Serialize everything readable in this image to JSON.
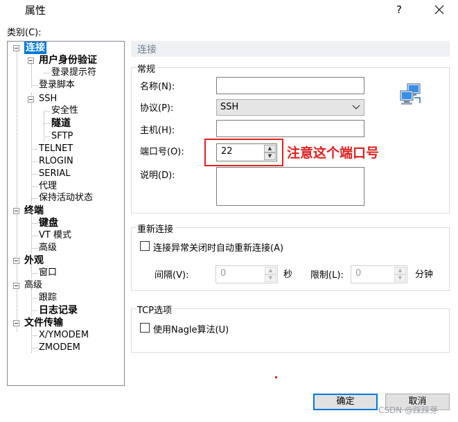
{
  "window": {
    "title": "属性",
    "help_label": "?"
  },
  "category": {
    "label": "类别(C):",
    "tree": [
      {
        "label": "连接",
        "selected": true,
        "bold": true
      },
      {
        "label": "用户身份验证",
        "bold": true
      },
      {
        "label": "登录提示符"
      },
      {
        "label": "登录脚本"
      },
      {
        "label": "SSH"
      },
      {
        "label": "安全性"
      },
      {
        "label": "隧道",
        "bold": true
      },
      {
        "label": "SFTP"
      },
      {
        "label": "TELNET"
      },
      {
        "label": "RLOGIN"
      },
      {
        "label": "SERIAL"
      },
      {
        "label": "代理"
      },
      {
        "label": "保持活动状态"
      },
      {
        "label": "终端",
        "bold": true
      },
      {
        "label": "键盘",
        "bold": true
      },
      {
        "label": "VT 模式"
      },
      {
        "label": "高级"
      },
      {
        "label": "外观",
        "bold": true
      },
      {
        "label": "窗口"
      },
      {
        "label": "高级"
      },
      {
        "label": "跟踪"
      },
      {
        "label": "日志记录",
        "bold": true
      },
      {
        "label": "文件传输",
        "bold": true
      },
      {
        "label": "X/YMODEM"
      },
      {
        "label": "ZMODEM"
      }
    ]
  },
  "panel": {
    "header": "连接",
    "general": {
      "group_label": "常规",
      "name_label": "名称(N):",
      "name_value": "",
      "protocol_label": "协议(P):",
      "protocol_value": "SSH",
      "host_label": "主机(H):",
      "host_value": "",
      "port_label": "端口号(O):",
      "port_value": "22",
      "desc_label": "说明(D):",
      "desc_value": ""
    },
    "reconnect": {
      "group_label": "重新连接",
      "checkbox_label": "连接异常关闭时自动重新连接(A)",
      "checked": false,
      "interval_label": "间隔(V):",
      "interval_value": "0",
      "interval_unit": "秒",
      "limit_label": "限制(L):",
      "limit_value": "0",
      "limit_unit": "分钟"
    },
    "tcp": {
      "group_label": "TCP选项",
      "nagle_label": "使用Nagle算法(U)",
      "checked": false
    }
  },
  "annotation": {
    "text": "注意这个端口号",
    "color": "#e02020"
  },
  "buttons": {
    "ok": "确定",
    "cancel": "取消"
  },
  "watermark": "CSDN @踩踩芽",
  "colors": {
    "selection": "#0078d7",
    "accent": "#0078d7"
  },
  "icons": {
    "connection": "network-computers-icon",
    "close": "close-icon"
  }
}
